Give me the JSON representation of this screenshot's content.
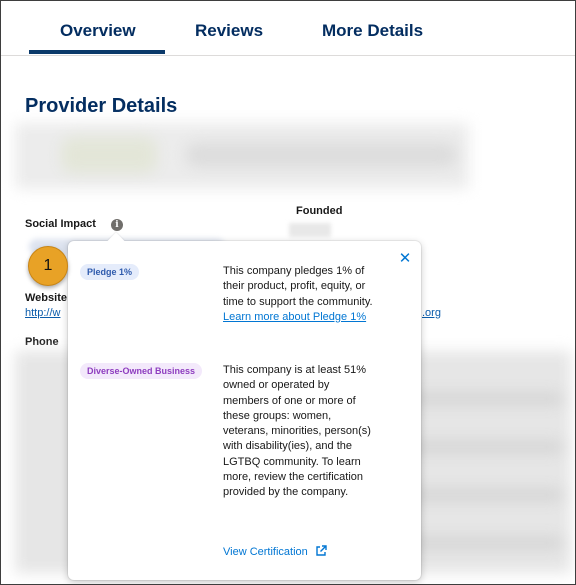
{
  "tabs": [
    {
      "label": "Overview",
      "active": true
    },
    {
      "label": "Reviews",
      "active": false
    },
    {
      "label": "More Details",
      "active": false
    }
  ],
  "page_title": "Provider Details",
  "fields": {
    "social_impact_label": "Social Impact",
    "founded_label": "Founded",
    "website_label": "Website",
    "website_value": "http://w",
    "website_suffix": ".org",
    "phone_label": "Phone"
  },
  "icons": {
    "info": "info-icon",
    "close": "close-icon",
    "external": "external-link-icon"
  },
  "popover": {
    "close_glyph": "✕",
    "items": [
      {
        "badge": "Pledge 1%",
        "text": "This company pledges 1% of their product, profit, equity, or time to support the community. ",
        "link": "Learn more about Pledge 1%"
      },
      {
        "badge": "Diverse-Owned Business",
        "text": "This company is at least 51% owned or operated by members of one or more of these groups: women, veterans, minorities, person(s) with disability(ies), and the LGTBQ community. To learn more, review the certification provided by the company."
      }
    ],
    "view_certification": "View Certification"
  },
  "step_badge": "1",
  "colors": {
    "tab_text": "#032d60",
    "tab_underline": "#0b3a6a",
    "link": "#0176d3",
    "pledge_badge_bg": "#e5ecfb",
    "pledge_badge_text": "#2e5aac",
    "diverse_badge_bg": "#f3e9fb",
    "diverse_badge_text": "#8e3dbf",
    "step_badge": "#e8a226"
  }
}
